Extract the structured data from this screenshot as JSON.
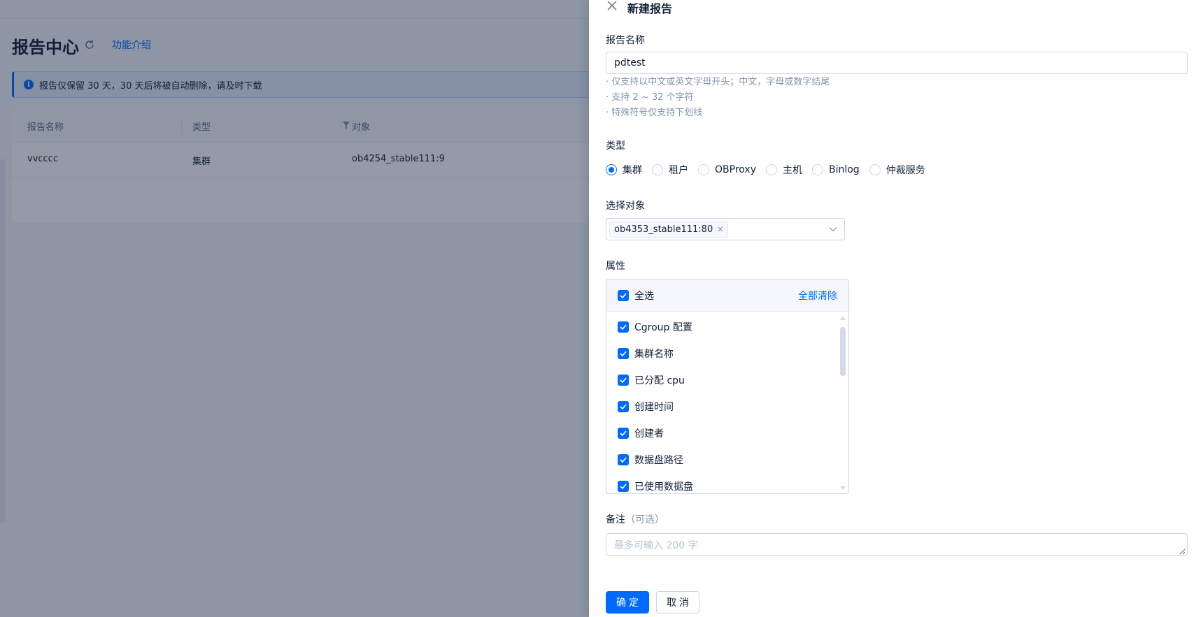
{
  "page": {
    "title": "报告中心",
    "intro_link": "功能介绍",
    "notice": "报告仅保留 30 天，30 天后将被自动删除，请及时下载",
    "table": {
      "headers": [
        "报告名称",
        "类型",
        "对象"
      ],
      "rows": [
        {
          "name": "vvcccc",
          "type": "集群",
          "object": "ob4254_stable111:9"
        }
      ]
    }
  },
  "drawer": {
    "title": "新建报告",
    "name_field": {
      "label": "报告名称",
      "value": "pdtest",
      "hints": [
        "· 仅支持以中文或英文字母开头；中文，字母或数字结尾",
        "· 支持 2 ~ 32 个字符",
        "· 特殊符号仅支持下划线"
      ]
    },
    "type_field": {
      "label": "类型",
      "options": [
        "集群",
        "租户",
        "OBProxy",
        "主机",
        "Binlog",
        "仲裁服务"
      ],
      "selected": "集群"
    },
    "target_field": {
      "label": "选择对象",
      "selected_tag": "ob4353_stable111:80"
    },
    "attributes_field": {
      "label": "属性",
      "select_all": "全选",
      "clear_all": "全部清除",
      "items": [
        "Cgroup 配置",
        "集群名称",
        "已分配 cpu",
        "创建时间",
        "创建者",
        "数据盘路径",
        "已使用数据盘"
      ]
    },
    "remark_field": {
      "label": "备注",
      "optional": "（可选）",
      "placeholder": "最多可输入 200 字"
    },
    "buttons": {
      "confirm": "确定",
      "cancel": "取消"
    }
  },
  "colors": {
    "primary": "#006aff",
    "text": "#132039",
    "hint": "#8592ad",
    "border": "#cdd5e4"
  }
}
